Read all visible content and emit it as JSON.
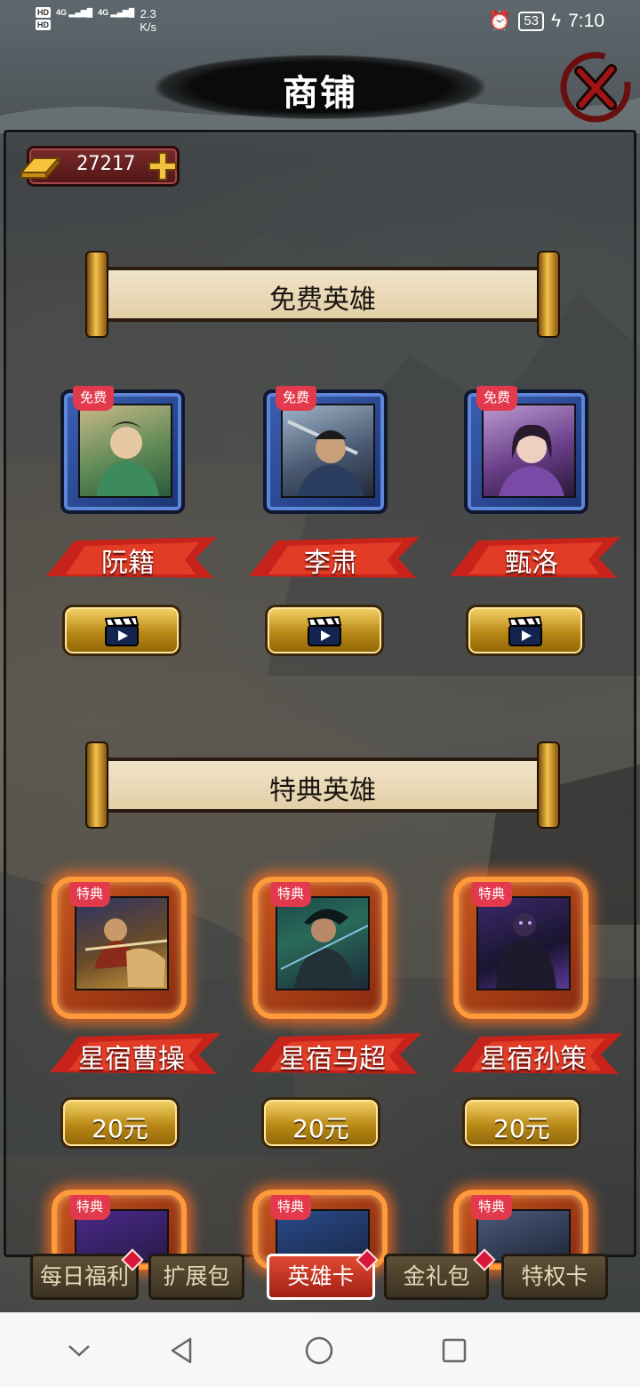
{
  "status_bar": {
    "hd1": "HD",
    "hd2": "HD",
    "signal1": "4G",
    "signal2": "4G",
    "speed_value": "2.3",
    "speed_unit": "K/s",
    "battery": "53",
    "time": "7:10"
  },
  "header": {
    "title": "商铺"
  },
  "currency": {
    "amount": "27217"
  },
  "sections": {
    "free": {
      "title": "免费英雄",
      "heroes": [
        {
          "tag": "免费",
          "name": "阮籍"
        },
        {
          "tag": "免费",
          "name": "李肃"
        },
        {
          "tag": "免费",
          "name": "甄洛"
        }
      ]
    },
    "special": {
      "title": "特典英雄",
      "heroes": [
        {
          "tag": "特典",
          "name": "星宿曹操",
          "price": "20元"
        },
        {
          "tag": "特典",
          "name": "星宿马超",
          "price": "20元"
        },
        {
          "tag": "特典",
          "name": "星宿孙策",
          "price": "20元"
        }
      ],
      "partial_tags": [
        "特典",
        "特典",
        "特典"
      ]
    }
  },
  "tabs": [
    {
      "label": "每日福利",
      "badge": true
    },
    {
      "label": "扩展包",
      "badge": false
    },
    {
      "label": "英雄卡",
      "badge": true,
      "active": true
    },
    {
      "label": "金礼包",
      "badge": true
    },
    {
      "label": "特权卡",
      "badge": false
    }
  ],
  "colors": {
    "active_tab": "#c8321f",
    "free_frame": "#3b5fb3",
    "special_frame": "#ff9a3a",
    "tag": "#e23a4c"
  }
}
